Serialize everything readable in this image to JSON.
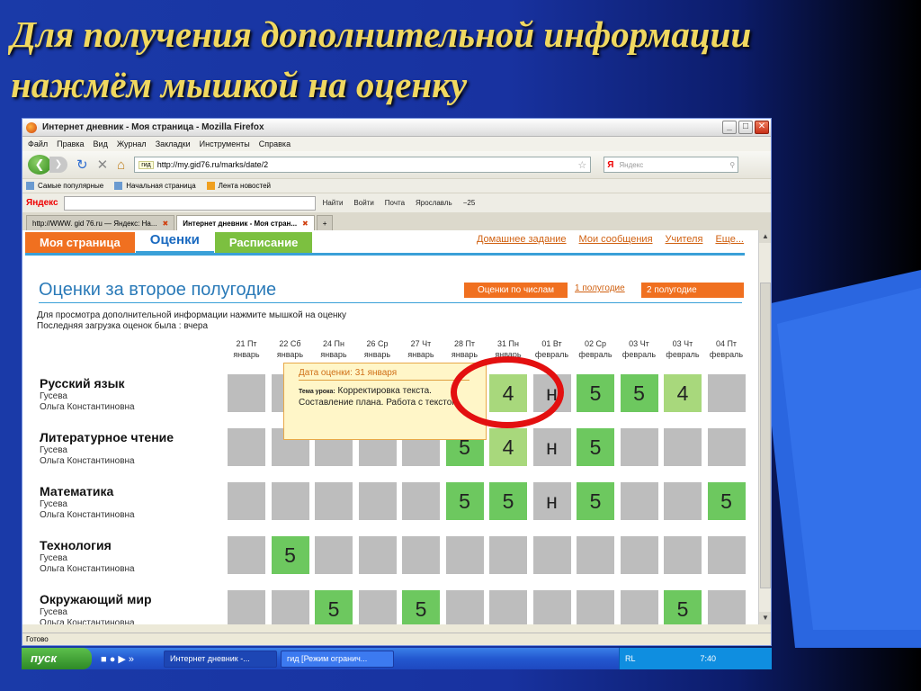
{
  "slide": {
    "title_line1": "Для получения дополнительной информации",
    "title_line2": "нажмём мышкой на оценку",
    "title_color": "#f0d860",
    "bg_color": "#1a3aa8"
  },
  "window": {
    "title": "Интернет дневник - Моя страница - Mozilla Firefox",
    "min": "_",
    "max": "□",
    "close": "✕"
  },
  "menu": [
    "Файл",
    "Правка",
    "Вид",
    "Журнал",
    "Закладки",
    "Инструменты",
    "Справка"
  ],
  "nav": {
    "url_badge": "гид",
    "url": "http://my.gid76.ru/marks/date/2",
    "search_brand": "Я",
    "search_placeholder": "Яндекс"
  },
  "bookmarks": [
    "Самые популярные",
    "Начальная страница",
    "Лента новостей"
  ],
  "yandex_bar": {
    "brand": "Яндекс",
    "items": [
      "Найти",
      "Войти",
      "Почта",
      "Ярославль",
      "−25"
    ]
  },
  "tabs": [
    {
      "label": "http://WWW. gid 76.ru — Яндекс: На...",
      "active": false
    },
    {
      "label": "Интернет дневник - Моя стран...",
      "active": true
    }
  ],
  "site": {
    "tab_my_page": "Моя страница",
    "tab_marks": "Оценки",
    "tab_schedule": "Расписание",
    "links": [
      "Домашнее задание",
      "Мои сообщения",
      "Учителя",
      "Еще..."
    ],
    "heading": "Оценки за второе полугодие",
    "btn_by_numbers": "Оценки по числам",
    "link_half1": "1 полугодие",
    "btn_half2": "2 полугодие",
    "info_line1": "Для просмотра дополнительной информации нажмите мышкой на оценку",
    "info_line2": "Последняя загрузка оценок была : вчера",
    "accent_orange": "#f07020",
    "accent_blue": "#3aa0d8"
  },
  "days": [
    {
      "d": "21 Пт",
      "m": "январь"
    },
    {
      "d": "22 Сб",
      "m": "январь"
    },
    {
      "d": "24 Пн",
      "m": "январь"
    },
    {
      "d": "26 Ср",
      "m": "январь"
    },
    {
      "d": "27 Чт",
      "m": "январь"
    },
    {
      "d": "28 Пт",
      "m": "январь"
    },
    {
      "d": "31 Пн",
      "m": "январь"
    },
    {
      "d": "01 Вт",
      "m": "февраль"
    },
    {
      "d": "02 Ср",
      "m": "февраль"
    },
    {
      "d": "03 Чт",
      "m": "февраль"
    },
    {
      "d": "03 Чт",
      "m": "февраль"
    },
    {
      "d": "04 Пт",
      "m": "февраль"
    }
  ],
  "subjects": [
    {
      "name": "Русский язык",
      "teacher1": "Гусева",
      "teacher2": "Ольга Константиновна",
      "marks": [
        "",
        "",
        "",
        "",
        "",
        "",
        "4",
        "н",
        "5",
        "5",
        "4",
        ""
      ],
      "style": [
        "g",
        "g",
        "g",
        "g",
        "g",
        "g",
        "l",
        "g",
        "G",
        "G",
        "l",
        "g"
      ]
    },
    {
      "name": "Литературное чтение",
      "teacher1": "Гусева",
      "teacher2": "Ольга Константиновна",
      "marks": [
        "",
        "",
        "",
        "",
        "",
        "5",
        "4",
        "н",
        "5",
        "",
        "",
        ""
      ],
      "style": [
        "g",
        "g",
        "g",
        "g",
        "g",
        "G",
        "l",
        "g",
        "G",
        "g",
        "g",
        "g"
      ]
    },
    {
      "name": "Математика",
      "teacher1": "Гусева",
      "teacher2": "Ольга Константиновна",
      "marks": [
        "",
        "",
        "",
        "",
        "",
        "5",
        "5",
        "н",
        "5",
        "",
        "",
        "5"
      ],
      "style": [
        "g",
        "g",
        "g",
        "g",
        "g",
        "G",
        "G",
        "g",
        "G",
        "g",
        "g",
        "G"
      ]
    },
    {
      "name": "Технология",
      "teacher1": "Гусева",
      "teacher2": "Ольга Константиновна",
      "marks": [
        "",
        "5",
        "",
        "",
        "",
        "",
        "",
        "",
        "",
        "",
        "",
        ""
      ],
      "style": [
        "g",
        "G",
        "g",
        "g",
        "g",
        "g",
        "g",
        "g",
        "g",
        "g",
        "g",
        "g"
      ]
    },
    {
      "name": "Окружающий мир",
      "teacher1": "Гусева",
      "teacher2": "Ольга Константиновна",
      "marks": [
        "",
        "",
        "5",
        "",
        "5",
        "",
        "",
        "",
        "",
        "",
        "5",
        ""
      ],
      "style": [
        "g",
        "g",
        "G",
        "g",
        "G",
        "g",
        "g",
        "g",
        "g",
        "g",
        "G",
        "g"
      ]
    }
  ],
  "tooltip": {
    "date": "Дата оценки: 31 января",
    "label": "Тема урока:",
    "text": "Корректировка текста. Составление плана. Работа с текстом"
  },
  "status": "Готово",
  "taskbar": {
    "start": "пуск",
    "tasks": [
      "Интернет дневник -...",
      "гид [Режим огранич..."
    ],
    "lang": "RL",
    "clock": "7:40"
  }
}
